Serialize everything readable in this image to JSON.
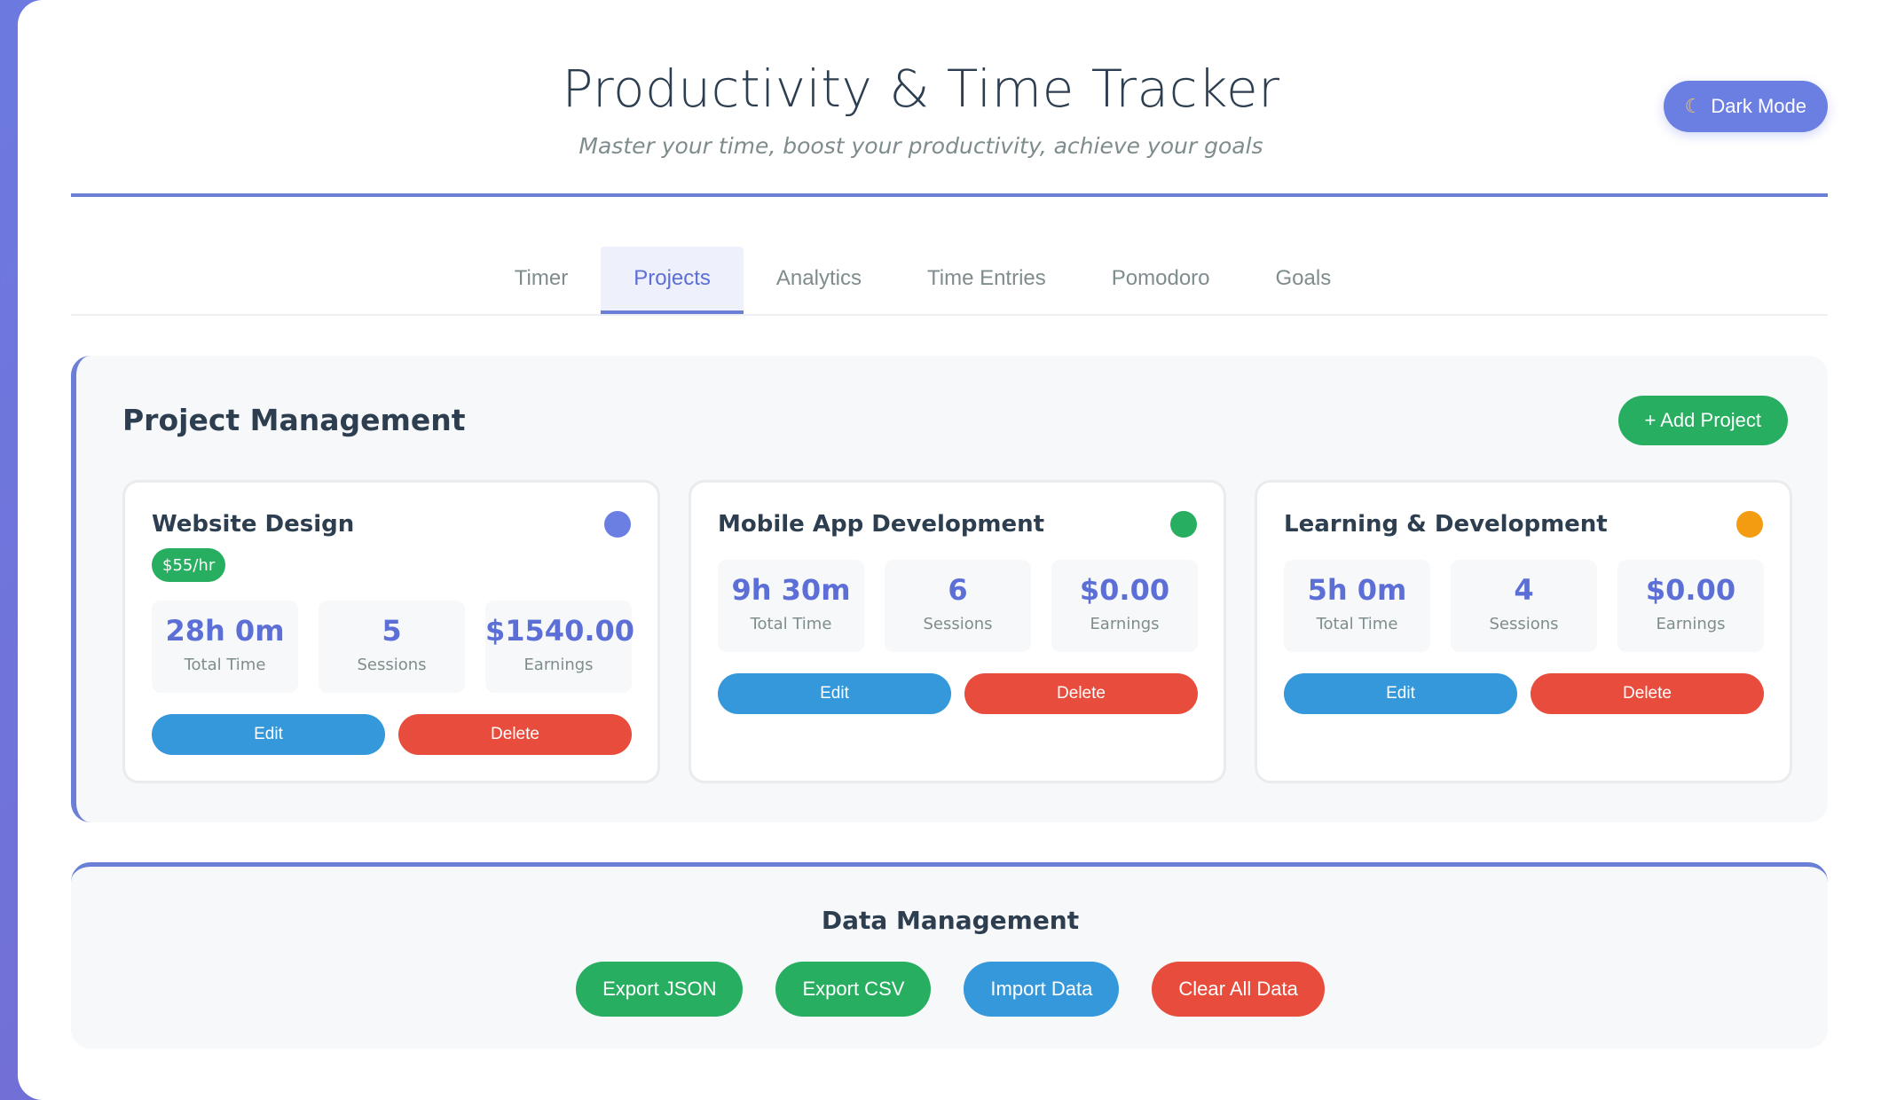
{
  "header": {
    "title": "Productivity & Time Tracker",
    "subtitle": "Master your time, boost your productivity, achieve your goals",
    "dark_mode_label": "Dark Mode",
    "dark_mode_icon": "moon-icon"
  },
  "tabs": [
    {
      "label": "Timer",
      "active": false
    },
    {
      "label": "Projects",
      "active": true
    },
    {
      "label": "Analytics",
      "active": false
    },
    {
      "label": "Time Entries",
      "active": false
    },
    {
      "label": "Pomodoro",
      "active": false
    },
    {
      "label": "Goals",
      "active": false
    }
  ],
  "projects_section": {
    "title": "Project Management",
    "add_label": "+ Add Project",
    "projects": [
      {
        "name": "Website Design",
        "color": "#6b7fe3",
        "rate": "$55/hr",
        "total_time": "28h 0m",
        "total_time_label": "Total Time",
        "sessions": "5",
        "sessions_label": "Sessions",
        "earnings": "$1540.00",
        "earnings_label": "Earnings",
        "edit_label": "Edit",
        "delete_label": "Delete"
      },
      {
        "name": "Mobile App Development",
        "color": "#27ae60",
        "rate": "",
        "total_time": "9h 30m",
        "total_time_label": "Total Time",
        "sessions": "6",
        "sessions_label": "Sessions",
        "earnings": "$0.00",
        "earnings_label": "Earnings",
        "edit_label": "Edit",
        "delete_label": "Delete"
      },
      {
        "name": "Learning & Development",
        "color": "#f39c12",
        "rate": "",
        "total_time": "5h 0m",
        "total_time_label": "Total Time",
        "sessions": "4",
        "sessions_label": "Sessions",
        "earnings": "$0.00",
        "earnings_label": "Earnings",
        "edit_label": "Edit",
        "delete_label": "Delete"
      }
    ]
  },
  "data_management": {
    "title": "Data Management",
    "export_json_label": "Export JSON",
    "export_csv_label": "Export CSV",
    "import_label": "Import Data",
    "clear_label": "Clear All Data"
  },
  "colors": {
    "accent": "#6b7fd7",
    "success": "#27ae60",
    "info": "#3498db",
    "danger": "#e74c3c"
  }
}
